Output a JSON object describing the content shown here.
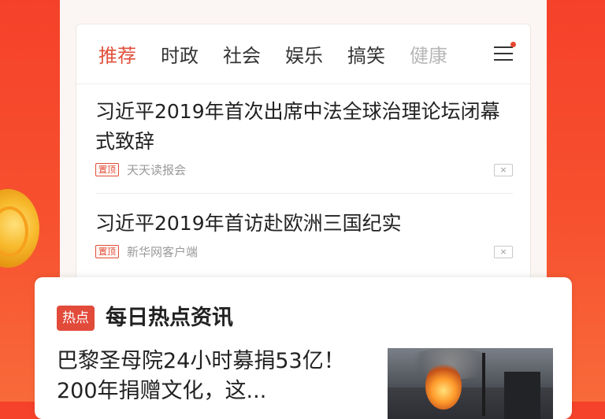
{
  "tabs": [
    {
      "label": "推荐",
      "active": true
    },
    {
      "label": "时政"
    },
    {
      "label": "社会"
    },
    {
      "label": "娱乐"
    },
    {
      "label": "搞笑"
    },
    {
      "label": "健康"
    }
  ],
  "news": [
    {
      "title": "习近平2019年首次出席中法全球治理论坛闭幕式致辞",
      "pin_label": "置顶",
      "source": "天天读报会",
      "close": "×"
    },
    {
      "title": "习近平2019年首访赴欧洲三国纪实",
      "pin_label": "置顶",
      "source": "新华网客户端",
      "close": "×"
    }
  ],
  "hot": {
    "badge": "热点",
    "title": "每日热点资讯",
    "headline": "巴黎圣母院24小时募捐53亿！200年捐赠文化，这..."
  },
  "colors": {
    "accent": "#e1503b",
    "background": "#f5412a"
  }
}
